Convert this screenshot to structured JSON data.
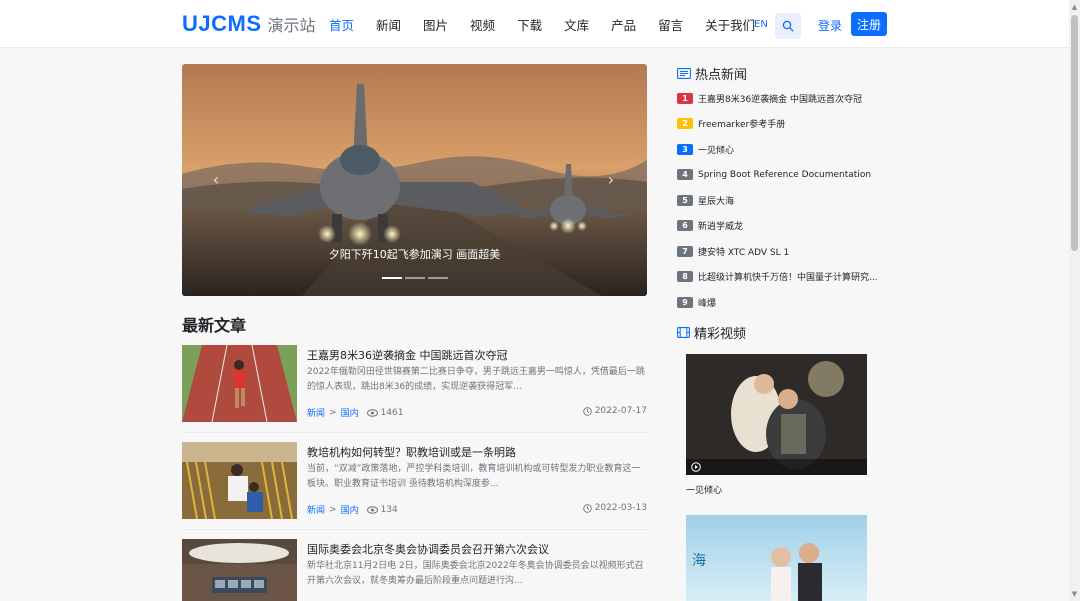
{
  "header": {
    "logo_main": "UJCMS",
    "logo_sub": "演示站",
    "nav": [
      "首页",
      "新闻",
      "图片",
      "视频",
      "下载",
      "文库",
      "产品",
      "留言",
      "关于我们"
    ],
    "active_nav": "首页",
    "lang": "EN",
    "login": "登录",
    "register": "注册"
  },
  "carousel": {
    "caption": "夕阳下歼10起飞参加演习 画面超美",
    "slides": 3,
    "active_slide": 1
  },
  "latest": {
    "title": "最新文章",
    "articles": [
      {
        "title": "王嘉男8米36逆袭摘金 中国跳远首次夺冠",
        "summary": "2022年俄勒冈田径世锦赛第二比赛日争夺，男子跳远王嘉男一鸣惊人，凭借最后一跳的惊人表现，跳出8米36的成绩，实现逆袭获得冠军...",
        "category": "新闻",
        "subcategory": "国内",
        "views": "1461",
        "date": "2022-07-17"
      },
      {
        "title": "教培机构如何转型？职教培训或是一条明路",
        "summary": "当前，“双减”政策落地，严控学科类培训，教育培训机构或可转型发力职业教育这一板块。职业教育证书培训 亟待教培机构深度参...",
        "category": "新闻",
        "subcategory": "国内",
        "views": "134",
        "date": "2022-03-13"
      },
      {
        "title": "国际奥委会北京冬奥会协调委员会召开第六次会议",
        "summary": "新华社北京11月2日电 2日，国际奥委会北京2022年冬奥会协调委员会以视频形式召开第六次会议，就冬奥筹办最后阶段重点问题进行沟...",
        "category": "新闻",
        "subcategory": "国内",
        "views": "",
        "date": ""
      }
    ]
  },
  "hot_news": {
    "title": "热点新闻",
    "items": [
      {
        "rank": "1",
        "text": "王嘉男8米36逆袭摘金 中国跳远首次夺冠",
        "color": "#dc3545"
      },
      {
        "rank": "2",
        "text": "Freemarker参考手册",
        "color": "#ffc107"
      },
      {
        "rank": "3",
        "text": "一见倾心",
        "color": "#0d6efd"
      },
      {
        "rank": "4",
        "text": "Spring Boot Reference Documentation",
        "color": "#6c757d"
      },
      {
        "rank": "5",
        "text": "星辰大海",
        "color": "#6c757d"
      },
      {
        "rank": "6",
        "text": "新逍学威龙",
        "color": "#6c757d"
      },
      {
        "rank": "7",
        "text": "捷安特 XTC ADV SL 1",
        "color": "#6c757d"
      },
      {
        "rank": "8",
        "text": "比超级计算机快千万倍！中国量子计算研究...",
        "color": "#6c757d"
      },
      {
        "rank": "9",
        "text": "峰爆",
        "color": "#6c757d"
      }
    ]
  },
  "videos": {
    "title": "精彩视频",
    "items": [
      {
        "title": "一见倾心"
      },
      {
        "title": ""
      }
    ]
  },
  "colors": {
    "primary": "#0d6efd",
    "muted": "#6c757d"
  }
}
